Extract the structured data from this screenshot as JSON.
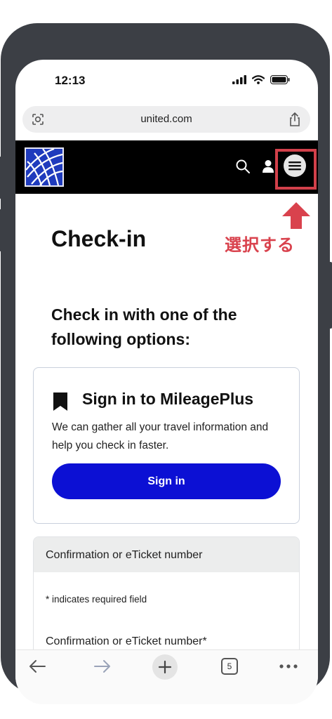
{
  "status_bar": {
    "time": "12:13"
  },
  "browser": {
    "url": "united.com",
    "open_tab_count": "5"
  },
  "page": {
    "title": "Check-in",
    "options_heading": "Check in with one of the following options:",
    "signin_card": {
      "title": "Sign in to MileagePlus",
      "description": "We can gather all your travel information and help you check in faster.",
      "button_label": "Sign in"
    },
    "form": {
      "section_title": "Confirmation or eTicket number",
      "required_note": "* indicates required field",
      "field_label": "Confirmation or eTicket number*"
    }
  },
  "annotation": {
    "label": "選択する",
    "color": "#d9424d"
  },
  "colors": {
    "brand_blue": "#0c10d4",
    "header_bg": "#000000",
    "logo_blue": "#1f3bbd"
  },
  "icons": [
    "camera-icon",
    "share-icon",
    "globe-logo-icon",
    "search-icon",
    "user-icon",
    "hamburger-menu-icon",
    "bookmark-icon",
    "back-arrow-icon",
    "forward-arrow-icon",
    "plus-icon",
    "tabs-icon",
    "more-icon",
    "up-arrow-icon"
  ]
}
